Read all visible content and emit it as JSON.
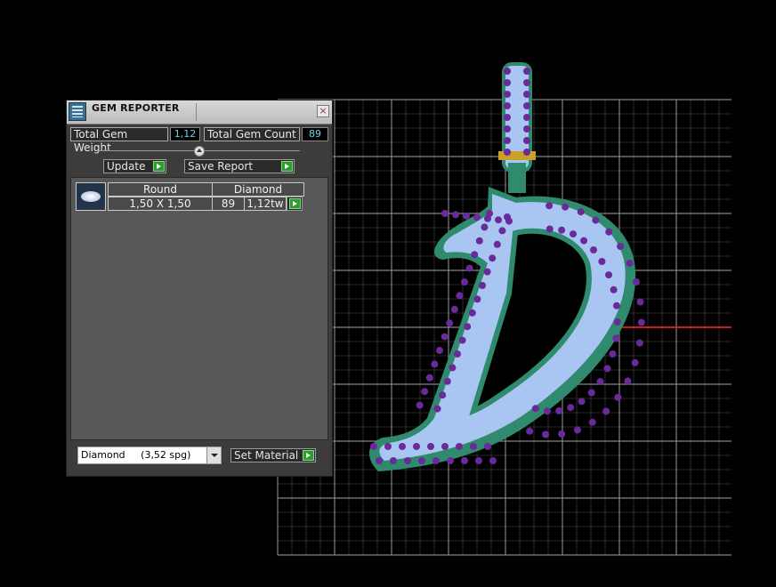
{
  "window": {
    "title": "GEM REPORTER",
    "close_glyph": "×"
  },
  "stats": {
    "total_weight_label": "Total Gem Weight",
    "total_weight_value": "1,12",
    "total_count_label": "Total Gem Count",
    "total_count_value": "89"
  },
  "actions": {
    "update_label": "Update",
    "save_report_label": "Save Report"
  },
  "gem_table": {
    "headers": [
      "Round",
      "Diamond"
    ],
    "rows": [
      {
        "size": "1,50 X 1,50",
        "count": "89",
        "weight": "1,12tw"
      }
    ]
  },
  "material": {
    "selected": "Diamond     (3,52 spg)",
    "set_label": "Set Material"
  },
  "icons": {
    "app": "gem-reporter-app-icon",
    "close": "close-icon",
    "collapse": "collapse-up-icon",
    "go": "green-play-arrow-icon",
    "gem": "round-diamond-thumbnail-icon",
    "dropdown": "chevron-down-icon"
  },
  "colors": {
    "viewport_bg": "#000000",
    "grid": "#8a8a8a",
    "axis": "#d01a1a",
    "letter_fill": "#a9c6f2",
    "letter_rim": "#2f8a6e",
    "prong": "#6a2a9a"
  }
}
